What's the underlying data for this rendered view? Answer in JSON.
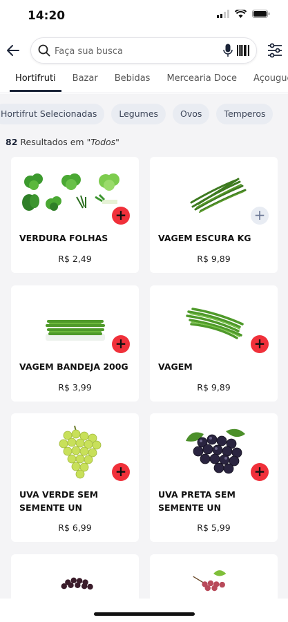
{
  "status": {
    "time": "14:20"
  },
  "search": {
    "placeholder": "Faça sua busca"
  },
  "tabs": [
    {
      "label": "Hortifruti"
    },
    {
      "label": "Bazar"
    },
    {
      "label": "Bebidas"
    },
    {
      "label": "Mercearia Doce"
    },
    {
      "label": "Açougue"
    }
  ],
  "chips": [
    {
      "label": "Hortifrut Selecionadas"
    },
    {
      "label": "Legumes"
    },
    {
      "label": "Ovos"
    },
    {
      "label": "Temperos"
    }
  ],
  "results": {
    "count": "82",
    "text": "Resultados em",
    "filter": "\"Todos\""
  },
  "products": [
    {
      "name": "VERDURA FOLHAS",
      "price": "R$ 2,49"
    },
    {
      "name": "VAGEM ESCURA KG",
      "price": "R$ 9,89"
    },
    {
      "name": "VAGEM BANDEJA 200G",
      "price": "R$ 3,99"
    },
    {
      "name": "VAGEM",
      "price": "R$ 9,89"
    },
    {
      "name": "UVA VERDE SEM SEMENTE UN",
      "price": "R$ 6,99"
    },
    {
      "name": "UVA PRETA SEM SEMENTE UN",
      "price": "R$ 5,99"
    }
  ],
  "colors": {
    "accent": "#f0303a",
    "primary": "#1b2438",
    "chip_bg": "#e9ecf2"
  }
}
